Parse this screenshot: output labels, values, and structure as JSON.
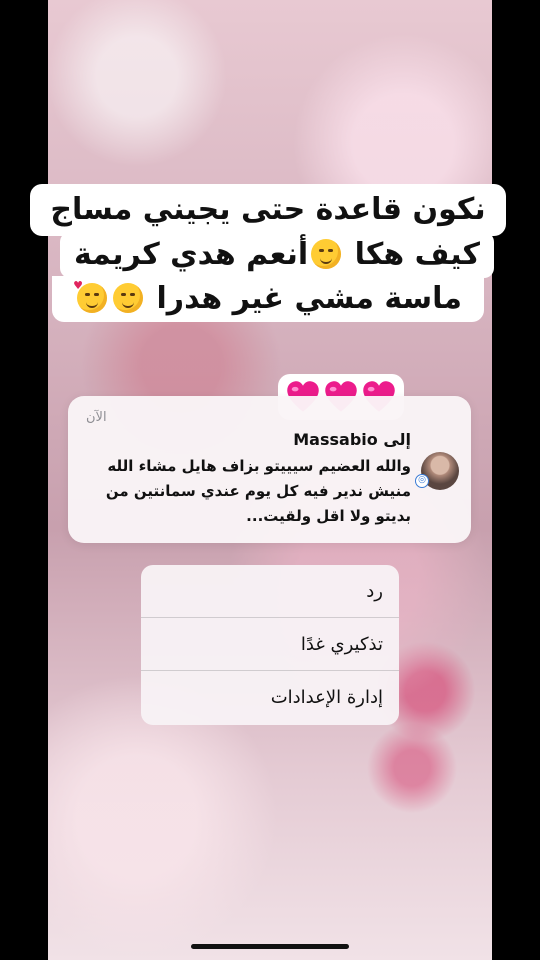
{
  "caption": {
    "line1": "نكون قاعدة حتى يجيني مساج",
    "line2_text": "كيف هكا",
    "line2_tail": "أنعم هدي كريمة",
    "line3": "ماسة  مشي غير هدرا"
  },
  "hearts": {
    "emoji": "💗💗💗",
    "color": "#e8189a"
  },
  "notification": {
    "time": "الآن",
    "title": "إلى Massabio",
    "body": "والله العضيم سيييتو بزاف هايل مشاء الله منيش ندير فيه كل يوم عندي سمانتين من بديتو ولا اقل ولقيت..."
  },
  "menu": {
    "items": [
      {
        "label": "رد"
      },
      {
        "label": "تذكيري غدًا"
      },
      {
        "label": "إدارة الإعدادات"
      }
    ]
  },
  "colors": {
    "heart": "#ec1c8c",
    "backdrop": "#d8b4c0"
  }
}
